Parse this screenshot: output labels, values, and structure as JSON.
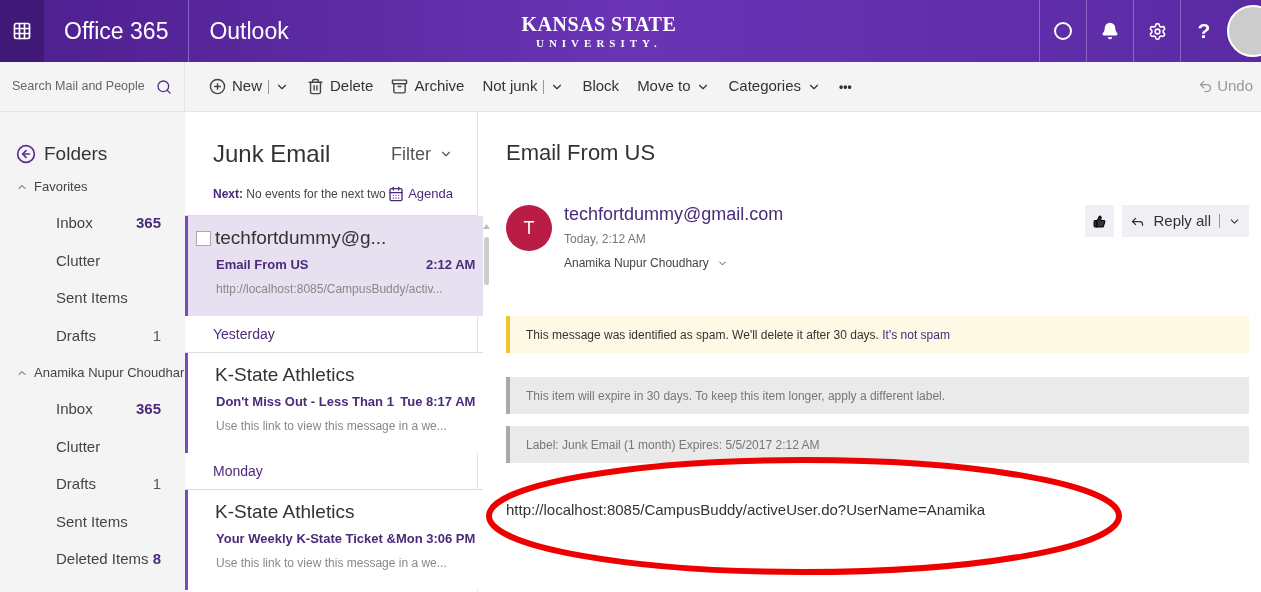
{
  "header": {
    "suite": "Office 365",
    "app": "Outlook",
    "logo": {
      "line1": "KANSAS STATE",
      "line2": "UNIVERSITY."
    },
    "help": "?"
  },
  "search": {
    "placeholder": "Search Mail and People"
  },
  "toolbar": {
    "commands": [
      {
        "label": "New",
        "split": true
      },
      {
        "label": "Delete"
      },
      {
        "label": "Archive"
      },
      {
        "label": "Not junk",
        "split": true
      },
      {
        "label": "Block"
      },
      {
        "label": "Move to",
        "menu": true
      },
      {
        "label": "Categories",
        "menu": true
      }
    ],
    "more": "•••",
    "undo": "Undo"
  },
  "folders": {
    "title": "Folders",
    "groups": [
      {
        "name": "Favorites",
        "expanded": true,
        "items": [
          {
            "name": "Inbox",
            "count": "365",
            "unread": true
          },
          {
            "name": "Clutter"
          },
          {
            "name": "Sent Items"
          },
          {
            "name": "Drafts",
            "count": "1",
            "unread": false
          }
        ]
      },
      {
        "name": "Anamika Nupur Choudhar",
        "expanded": true,
        "items": [
          {
            "name": "Inbox",
            "count": "365",
            "unread": true
          },
          {
            "name": "Clutter"
          },
          {
            "name": "Drafts",
            "count": "1",
            "unread": false
          },
          {
            "name": "Sent Items"
          },
          {
            "name": "Deleted Items",
            "count": "8",
            "unread": true
          }
        ]
      }
    ]
  },
  "message_list": {
    "title": "Junk Email",
    "filter": "Filter",
    "next_label": "Next:",
    "next_text": "No events for the next two",
    "agenda": "Agenda",
    "entries": [
      {
        "kind": "message",
        "sender": "techfortdummy@g...",
        "subject": "Email From US",
        "time": "2:12 AM",
        "preview": "http://localhost:8085/CampusBuddy/activ...",
        "selected": true,
        "unread": true
      },
      {
        "kind": "header",
        "label": "Yesterday"
      },
      {
        "kind": "message",
        "sender": "K-State Athletics",
        "subject": "Don't Miss Out - Less Than 1",
        "time": "Tue 8:17 AM",
        "preview": "Use this link to view this message in a we...",
        "selected": false,
        "unread": true
      },
      {
        "kind": "header",
        "label": "Monday"
      },
      {
        "kind": "message",
        "sender": "K-State Athletics",
        "subject": "Your Weekly K-State Ticket &",
        "time": "Mon 3:06 PM",
        "preview": "Use this link to view this message in a we...",
        "selected": false,
        "unread": true
      }
    ]
  },
  "reading": {
    "subject": "Email From US",
    "avatar": {
      "initial": "T",
      "color": "#b91c44"
    },
    "from": "techfortdummy@gmail.com",
    "date": "Today, 2:12 AM",
    "to": "Anamika Nupur Choudhary",
    "reply_all": "Reply all",
    "notices": [
      {
        "kind": "spam",
        "text": "This message was identified as spam. We'll delete it after 30 days.",
        "link": "It's not spam"
      },
      {
        "kind": "info",
        "text": "This item will expire in 30 days. To keep this item longer, apply a different label."
      },
      {
        "kind": "info",
        "text": "Label: Junk Email (1 month) Expires: 5/5/2017 2:12 AM"
      }
    ],
    "body": "http://localhost:8085/CampusBuddy/activeUser.do?UserName=Anamika"
  }
}
